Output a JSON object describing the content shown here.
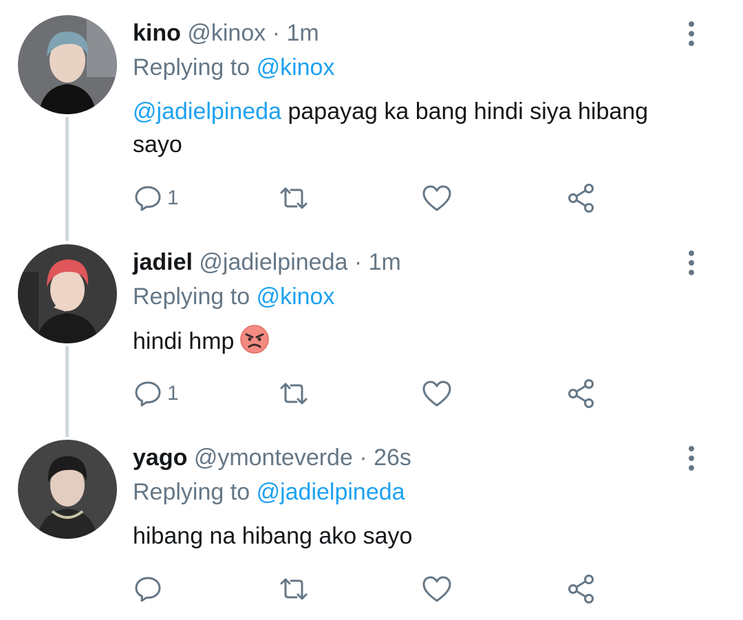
{
  "tweets": [
    {
      "name": "kino",
      "handle": "@kinox",
      "separator": "·",
      "time": "1m",
      "replying_prefix": "Replying to",
      "replying_to": "@kinox",
      "mention": "@jadielpineda",
      "text": " papayag ka bang hindi siya hibang sayo",
      "reply_count": "1",
      "avatar_colors": {
        "bg": "#6d6f73",
        "hair": "#7fa3b3",
        "face": "#e8d2c4",
        "body": "#111111"
      }
    },
    {
      "name": "jadiel",
      "handle": "@jadielpineda",
      "separator": "·",
      "time": "1m",
      "replying_prefix": "Replying to",
      "replying_to": "@kinox",
      "text": "hindi hmp",
      "emoji": "angry-face-emoji",
      "reply_count": "1",
      "avatar_colors": {
        "bg": "#3b3b3b",
        "hair": "#e0565a",
        "face": "#ecd4c6",
        "body": "#1a1a1a"
      }
    },
    {
      "name": "yago",
      "handle": "@ymonteverde",
      "separator": "·",
      "time": "26s",
      "replying_prefix": "Replying to",
      "replying_to": "@jadielpineda",
      "text": "hibang na hibang ako sayo",
      "reply_count": "",
      "avatar_colors": {
        "bg": "#444444",
        "hair": "#1c1c1c",
        "face": "#e3ccc0",
        "body": "#262626"
      }
    }
  ],
  "colors": {
    "accent": "#1da1f2",
    "muted": "#657786",
    "thread_line": "#cfd9de"
  },
  "icons": [
    "reply-icon",
    "retweet-icon",
    "like-icon",
    "share-icon",
    "more-icon"
  ]
}
